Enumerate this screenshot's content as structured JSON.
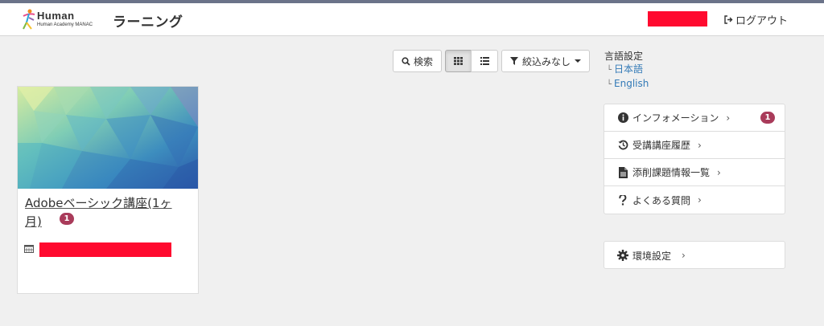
{
  "header": {
    "logo_main": "Human",
    "logo_sub": "Human Academy MANAC",
    "app_title": "ラーニング",
    "logout_label": "ログアウト"
  },
  "toolbar": {
    "search_label": "検索",
    "grid_view_icon": "grid-icon",
    "list_view_icon": "list-icon",
    "filter_label": "絞込みなし"
  },
  "language": {
    "title": "言語設定",
    "options": [
      "日本語",
      "English"
    ]
  },
  "course_card": {
    "title": "Adobeベーシック講座(1ヶ月)",
    "badge": "1"
  },
  "menu": {
    "items": [
      {
        "label": "インフォメーション",
        "icon": "info-icon",
        "badge": "1"
      },
      {
        "label": "受講講座履歴",
        "icon": "history-icon"
      },
      {
        "label": "添削課題情報一覧",
        "icon": "document-icon"
      },
      {
        "label": "よくある質問",
        "icon": "question-icon"
      }
    ],
    "settings_label": "環境設定"
  },
  "colors": {
    "accent_link": "#337ab7",
    "badge": "#a93b5a",
    "redaction": "#ff0a2f"
  }
}
